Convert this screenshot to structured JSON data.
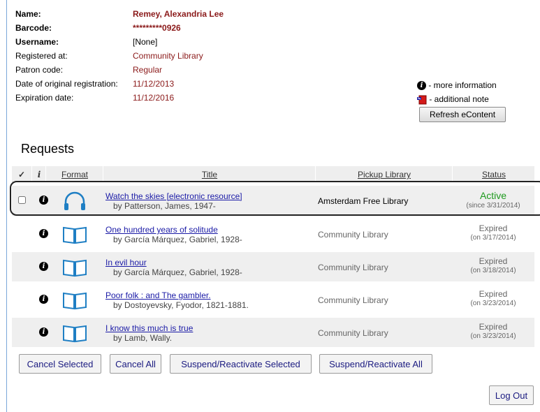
{
  "patron": {
    "name_label": "Name:",
    "name": "Remey, Alexandria Lee",
    "barcode_label": "Barcode:",
    "barcode": "*********0926",
    "username_label": "Username:",
    "username": "[None]",
    "registered_label": "Registered at:",
    "registered": "Community Library",
    "code_label": "Patron code:",
    "code": "Regular",
    "orig_label": "Date of original registration:",
    "orig": "11/12/2013",
    "exp_label": "Expiration date:",
    "exp": "11/12/2016"
  },
  "legend": {
    "info_text": "- more information",
    "note_text": "- additional note",
    "refresh_label": "Refresh eContent",
    "info_glyph": "i"
  },
  "requests": {
    "heading": "Requests",
    "columns": {
      "check": "✓",
      "info": "i",
      "format": "Format",
      "title": "Title",
      "pickup": "Pickup Library",
      "status": "Status"
    },
    "rows": [
      {
        "format_icon": "headphones-icon",
        "title": "Watch the skies [electronic resource]",
        "author": "by Patterson, James, 1947-",
        "pickup": "Amsterdam Free Library",
        "status": "Active",
        "status_date": "(since 3/31/2014)"
      },
      {
        "format_icon": "book-icon",
        "title": "One hundred years of solitude",
        "author": "by García Márquez, Gabriel, 1928-",
        "pickup": "Community Library",
        "status": "Expired",
        "status_date": "(on 3/17/2014)"
      },
      {
        "format_icon": "book-icon",
        "title": "In evil hour",
        "author": "by García Márquez, Gabriel, 1928-",
        "pickup": "Community Library",
        "status": "Expired",
        "status_date": "(on 3/18/2014)"
      },
      {
        "format_icon": "book-icon",
        "title": "Poor folk : and The gambler.",
        "author": "by Dostoyevsky, Fyodor, 1821-1881.",
        "pickup": "Community Library",
        "status": "Expired",
        "status_date": "(on 3/23/2014)"
      },
      {
        "format_icon": "book-icon",
        "title": "I know this much is true",
        "author": "by Lamb, Wally.",
        "pickup": "Community Library",
        "status": "Expired",
        "status_date": "(on 3/23/2014)"
      }
    ]
  },
  "actions": {
    "cancel_selected": "Cancel Selected",
    "cancel_all": "Cancel All",
    "suspend_selected": "Suspend/Reactivate Selected",
    "suspend_all": "Suspend/Reactivate All",
    "logout": "Log Out"
  },
  "colors": {
    "value_red": "#8b1a1a",
    "link_blue": "#1a1aa6",
    "active_green": "#1d9a1d",
    "format_icon_blue": "#1f7fc4"
  }
}
